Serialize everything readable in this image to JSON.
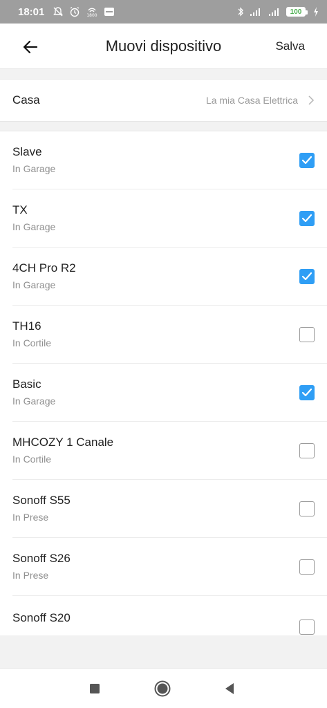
{
  "status_bar": {
    "time": "18:01",
    "battery": "100",
    "left_icons": [
      "muted-bell-icon",
      "alarm-clock-icon",
      "hotspot-icon",
      "message-icon"
    ],
    "right_icons": [
      "bluetooth-icon",
      "signal-icon",
      "signal-icon",
      "battery-icon",
      "charging-icon"
    ]
  },
  "header": {
    "title": "Muovi dispositivo",
    "save_label": "Salva",
    "back_icon": "arrow-left-icon"
  },
  "home": {
    "label": "Casa",
    "value": "La mia Casa Elettrica",
    "icon": "chevron-right-icon"
  },
  "devices": [
    {
      "name": "Slave",
      "room": "In Garage",
      "checked": true
    },
    {
      "name": "TX",
      "room": "In Garage",
      "checked": true
    },
    {
      "name": "4CH Pro R2",
      "room": "In Garage",
      "checked": true
    },
    {
      "name": "TH16",
      "room": "In Cortile",
      "checked": false
    },
    {
      "name": "Basic",
      "room": "In Garage",
      "checked": true
    },
    {
      "name": "MHCOZY 1 Canale",
      "room": "In Cortile",
      "checked": false
    },
    {
      "name": "Sonoff S55",
      "room": "In Prese",
      "checked": false
    },
    {
      "name": "Sonoff S26",
      "room": "In Prese",
      "checked": false
    },
    {
      "name": "Sonoff S20",
      "room": "",
      "checked": false
    }
  ],
  "colors": {
    "accent": "#2f9ef5",
    "statusbar": "#9e9e9e",
    "background": "#f2f2f2"
  },
  "navbar": {
    "icons": [
      "recents-square-icon",
      "home-circle-icon",
      "back-triangle-icon"
    ]
  }
}
